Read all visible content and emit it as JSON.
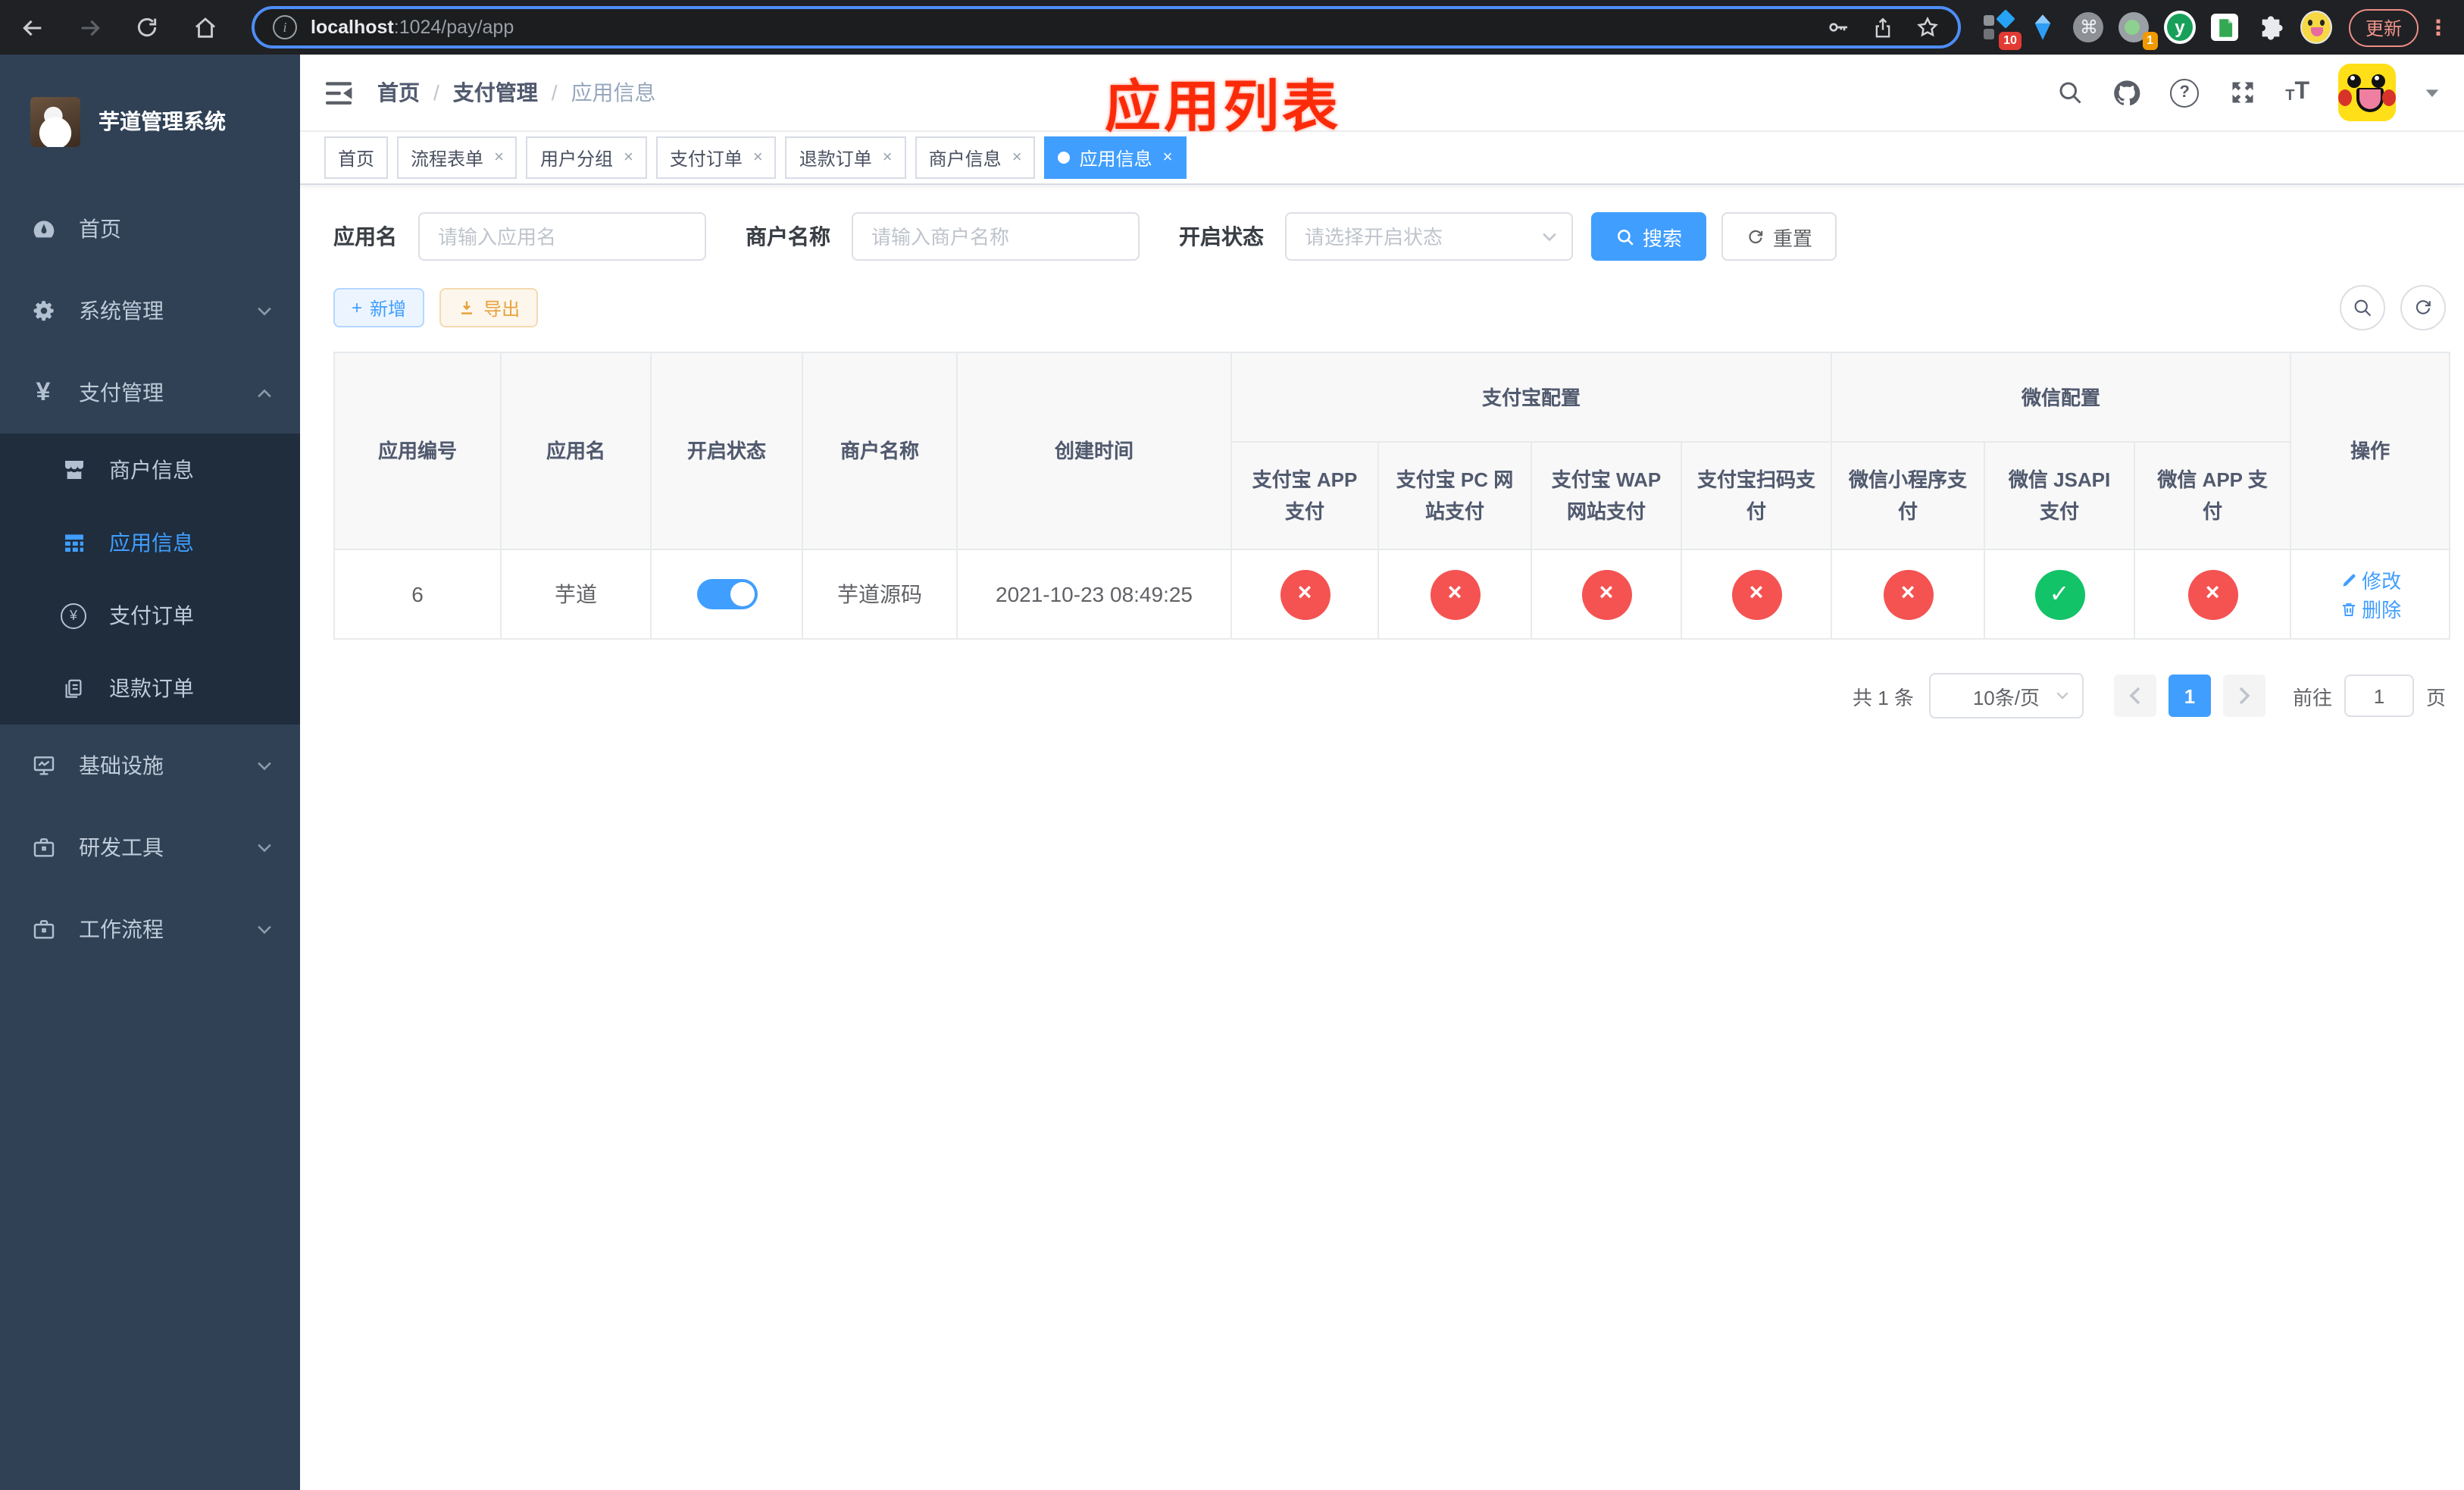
{
  "colors": {
    "accent": "#409eff",
    "accent-bg": "#ecf5ff",
    "accent-border": "#b3d8ff",
    "danger": "#f45352",
    "success": "#12c368",
    "warning": "#e6a23c",
    "warning-bg": "#fdf6ec",
    "warning-border": "#f5dab1",
    "sidebar-bg": "#304156",
    "submenu-bg": "#1f2d3d",
    "annotation": "#fb2b09",
    "chrome-bg": "#202124"
  },
  "annotation": {
    "title": "应用列表"
  },
  "browser": {
    "url_host": "localhost",
    "url_path": ":1024/pay/app",
    "update_label": "更新",
    "menu_dots": "⋮",
    "ext_badge_grid": "10",
    "ext_badge_proxy": "1",
    "ext_y_label": "y"
  },
  "sidebar": {
    "title": "芋道管理系统",
    "home": "首页",
    "system": "系统管理",
    "payment": "支付管理",
    "merchant_info": "商户信息",
    "app_info": "应用信息",
    "pay_order": "支付订单",
    "refund_order": "退款订单",
    "infra": "基础设施",
    "dev_tools": "研发工具",
    "workflow": "工作流程"
  },
  "navbar": {
    "breadcrumb_home": "首页",
    "breadcrumb_section": "支付管理",
    "breadcrumb_current": "应用信息",
    "separator": "/"
  },
  "tags": {
    "t0": "首页",
    "t1": "流程表单",
    "t2": "用户分组",
    "t3": "支付订单",
    "t4": "退款订单",
    "t5": "商户信息",
    "t6": "应用信息"
  },
  "filters": {
    "app_name_label": "应用名",
    "app_name_placeholder": "请输入应用名",
    "merchant_label": "商户名称",
    "merchant_placeholder": "请输入商户名称",
    "status_label": "开启状态",
    "status_placeholder": "请选择开启状态",
    "search_label": "搜索",
    "reset_label": "重置"
  },
  "toolbar": {
    "add_label": "新增",
    "export_label": "导出"
  },
  "table": {
    "group_alipay": "支付宝配置",
    "group_wechat": "微信配置",
    "col_app_id": "应用编号",
    "col_app_name": "应用名",
    "col_status": "开启状态",
    "col_merchant": "商户名称",
    "col_created": "创建时间",
    "col_actions": "操作",
    "pay_cols": [
      "支付宝 APP 支付",
      "支付宝 PC 网站支付",
      "支付宝 WAP 网站支付",
      "支付宝扫码支付",
      "微信小程序支付",
      "微信 JSAPI 支付",
      "微信 APP 支付"
    ],
    "row": {
      "id": "6",
      "name": "芋道",
      "enabled": true,
      "merchant": "芋道源码",
      "created": "2021-10-23 08:49:25",
      "statuses": [
        false,
        false,
        false,
        false,
        false,
        true,
        false
      ],
      "edit_label": "修改",
      "delete_label": "删除"
    }
  },
  "pagination": {
    "total": "共 1 条",
    "page_size": "10条/页",
    "page": "1",
    "goto_label": "前往",
    "goto_value": "1",
    "unit_label": "页"
  }
}
